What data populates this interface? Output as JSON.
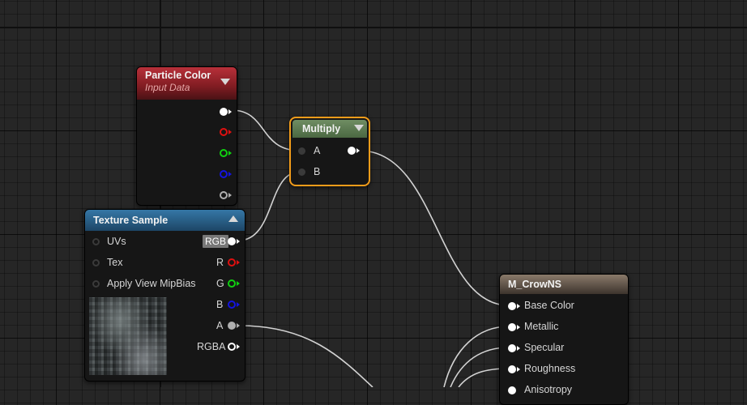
{
  "nodes": {
    "particle_color": {
      "title": "Particle Color",
      "subtitle": "Input Data"
    },
    "multiply": {
      "title": "Multiply",
      "inputs": [
        "A",
        "B"
      ]
    },
    "texture_sample": {
      "title": "Texture Sample",
      "inputs": [
        "UVs",
        "Tex",
        "Apply View MipBias"
      ],
      "outputs": [
        "RGB",
        "R",
        "G",
        "B",
        "A",
        "RGBA"
      ]
    },
    "material": {
      "title": "M_CrowNS",
      "inputs": [
        "Base Color",
        "Metallic",
        "Specular",
        "Roughness",
        "Anisotropy"
      ]
    }
  },
  "colors": {
    "particle_header": "#a1252b",
    "multiply_header": "#5c7a52",
    "texture_header": "#2a5f86",
    "material_header": "#5b5148",
    "selection": "#f39c1a",
    "pin_white": "#ffffff",
    "pin_red": "#e01010",
    "pin_green": "#10d010",
    "pin_blue": "#1414e0",
    "pin_alpha": "#b0b0b0"
  }
}
